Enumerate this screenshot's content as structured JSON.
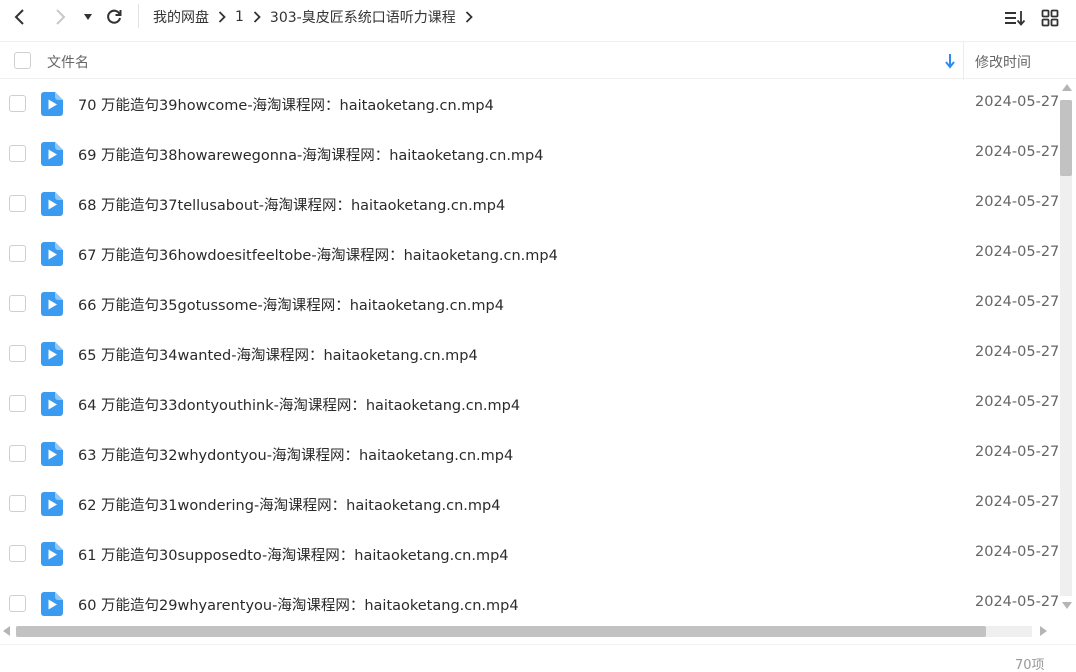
{
  "breadcrumb": [
    "我的网盘",
    "1",
    "303-臭皮匠系统口语听力课程"
  ],
  "header": {
    "name_label": "文件名",
    "time_label": "修改时间"
  },
  "files": [
    {
      "name": "70 万能造句39howcome-海淘课程网：haitaoketang.cn.mp4",
      "time": "2024-05-27"
    },
    {
      "name": "69 万能造句38howarewegonna-海淘课程网：haitaoketang.cn.mp4",
      "time": "2024-05-27"
    },
    {
      "name": "68 万能造句37tellusabout-海淘课程网：haitaoketang.cn.mp4",
      "time": "2024-05-27"
    },
    {
      "name": "67 万能造句36howdoesitfeeltobe-海淘课程网：haitaoketang.cn.mp4",
      "time": "2024-05-27"
    },
    {
      "name": "66 万能造句35gotussome-海淘课程网：haitaoketang.cn.mp4",
      "time": "2024-05-27"
    },
    {
      "name": "65 万能造句34wanted-海淘课程网：haitaoketang.cn.mp4",
      "time": "2024-05-27"
    },
    {
      "name": "64 万能造句33dontyouthink-海淘课程网：haitaoketang.cn.mp4",
      "time": "2024-05-27"
    },
    {
      "name": "63 万能造句32whydontyou-海淘课程网：haitaoketang.cn.mp4",
      "time": "2024-05-27"
    },
    {
      "name": "62 万能造句31wondering-海淘课程网：haitaoketang.cn.mp4",
      "time": "2024-05-27"
    },
    {
      "name": "61 万能造句30supposedto-海淘课程网：haitaoketang.cn.mp4",
      "time": "2024-05-27"
    },
    {
      "name": "60 万能造句29whyarentyou-海淘课程网：haitaoketang.cn.mp4",
      "time": "2024-05-27"
    }
  ],
  "status": {
    "item_count": "70项"
  },
  "icons": {
    "file_icon": "video-file-icon",
    "accent": "#3a9bf0",
    "sort_color": "#2d8cf0"
  }
}
